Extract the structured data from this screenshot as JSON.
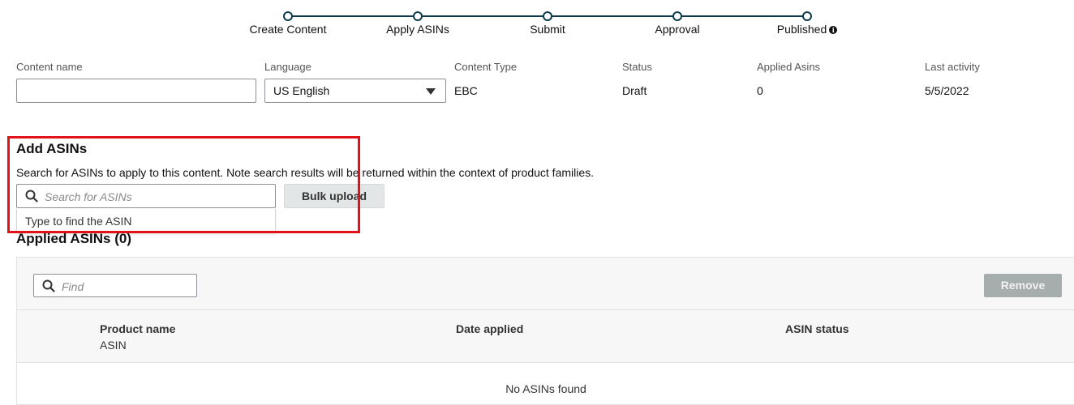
{
  "stepper": {
    "steps": [
      {
        "label": "Create Content"
      },
      {
        "label": "Apply ASINs"
      },
      {
        "label": "Submit"
      },
      {
        "label": "Approval"
      },
      {
        "label": "Published"
      }
    ],
    "info_icon_glyph": "i"
  },
  "meta": {
    "content_name": {
      "label": "Content name",
      "value": ""
    },
    "language": {
      "label": "Language",
      "value": "US English"
    },
    "content_type": {
      "label": "Content Type",
      "value": "EBC"
    },
    "status": {
      "label": "Status",
      "value": "Draft"
    },
    "applied_asins": {
      "label": "Applied Asins",
      "value": "0"
    },
    "last_activity": {
      "label": "Last activity",
      "value": "5/5/2022"
    }
  },
  "add_asins": {
    "title": "Add ASINs",
    "description": "Search for ASINs to apply to this content. Note search results will be returned within the context of product families.",
    "search_placeholder": "Search for ASINs",
    "suggestion_hint": "Type to find the ASIN",
    "bulk_upload_label": "Bulk upload"
  },
  "applied": {
    "title": "Applied ASINs (0)",
    "find_placeholder": "Find",
    "remove_label": "Remove",
    "columns": {
      "product_name": "Product name",
      "asin": "ASIN",
      "date_applied": "Date applied",
      "asin_status": "ASIN status"
    },
    "empty_message": "No ASINs found"
  },
  "colors": {
    "stepper_line": "#0f3a4a",
    "highlight": "#e0131a",
    "remove_disabled": "#a6adad",
    "secondary_button": "#e3e6e6"
  },
  "icons": [
    "search-icon",
    "dropdown-caret-icon",
    "info-icon"
  ]
}
